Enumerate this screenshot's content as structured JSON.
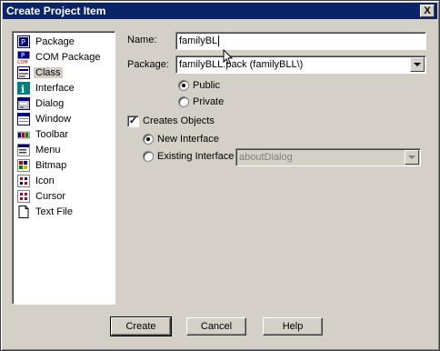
{
  "window": {
    "title": "Create Project Item",
    "close_label": "X"
  },
  "item_list": [
    {
      "label": "Package",
      "icon": "package-icon"
    },
    {
      "label": "COM Package",
      "icon": "com-package-icon"
    },
    {
      "label": "Class",
      "icon": "class-icon",
      "selected": true
    },
    {
      "label": "Interface",
      "icon": "interface-icon"
    },
    {
      "label": "Dialog",
      "icon": "dialog-icon"
    },
    {
      "label": "Window",
      "icon": "window-icon"
    },
    {
      "label": "Toolbar",
      "icon": "toolbar-icon"
    },
    {
      "label": "Menu",
      "icon": "menu-icon"
    },
    {
      "label": "Bitmap",
      "icon": "bitmap-icon"
    },
    {
      "label": "Icon",
      "icon": "icon-icon"
    },
    {
      "label": "Cursor",
      "icon": "cursor-icon"
    },
    {
      "label": "Text File",
      "icon": "text-file-icon"
    }
  ],
  "form": {
    "name_label": "Name:",
    "name_value": "familyBL",
    "package_label": "Package:",
    "package_value": "familyBLL.pack (familyBLL\\)",
    "visibility": {
      "public_label": "Public",
      "private_label": "Private",
      "selected": "Public"
    },
    "creates_objects_label": "Creates Objects",
    "creates_objects_checked": true,
    "new_interface_label": "New Interface",
    "existing_interface_label": "Existing Interface",
    "interface_selected": "New Interface",
    "existing_interface_value": "aboutDialog"
  },
  "buttons": {
    "create": "Create",
    "cancel": "Cancel",
    "help": "Help"
  }
}
